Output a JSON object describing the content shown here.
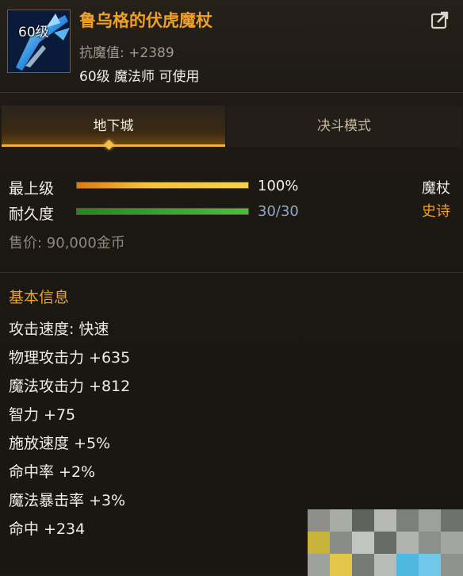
{
  "item": {
    "level_tag": "60级",
    "name": "鲁乌格的伏虎魔杖",
    "magic_resist": "抗魔值: +2389",
    "requirement": "60级 魔法师 可使用"
  },
  "tabs": [
    {
      "label": "地下城",
      "active": true
    },
    {
      "label": "决斗模式",
      "active": false
    }
  ],
  "grade": {
    "label": "最上级",
    "value": "100%",
    "fraction": 1.0
  },
  "durability": {
    "label": "耐久度",
    "value": "30/30",
    "fraction": 1.0
  },
  "weapon_type": "魔杖",
  "rarity": "史诗",
  "price": "售价: 90,000金币",
  "basic_info": {
    "title": "基本信息",
    "attributes": [
      "攻击速度: 快速",
      "物理攻击力 +635",
      "魔法攻击力 +812",
      "智力 +75",
      "施放速度 +5%",
      "命中率 +2%",
      "魔法暴击率 +3%",
      "命中 +234"
    ]
  },
  "icons": {
    "share": "share-export-icon",
    "item": "staff-item-icon"
  },
  "colors": {
    "accent": "#f0a023",
    "epic": "#f0a023",
    "durability_text": "#8fa6c8"
  }
}
